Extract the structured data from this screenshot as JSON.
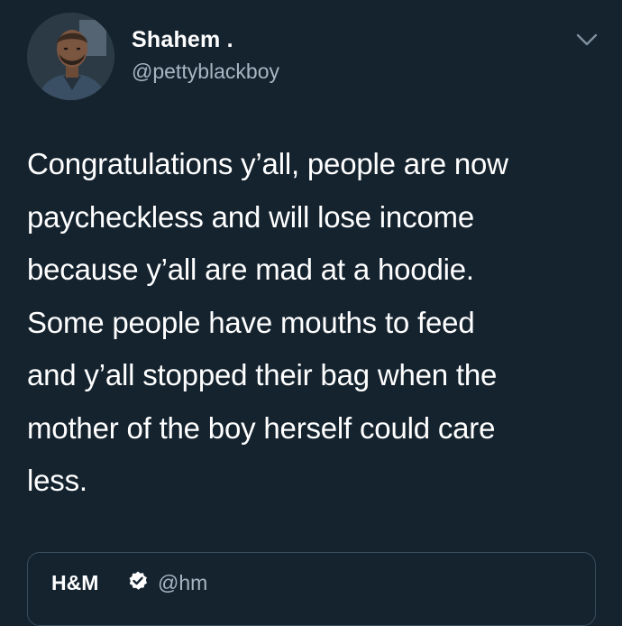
{
  "theme": {
    "background": "#15232f",
    "text": "#ffffff",
    "secondary_text": "#a8b6c3",
    "border": "#3a4d5c"
  },
  "tweet": {
    "author": {
      "display_name": "Shahem .",
      "handle": "@pettyblackboy",
      "avatar_icon": "profile-photo"
    },
    "menu_icon": "chevron-down-icon",
    "text": "Congratulations y’all, people are now\npaycheckless and will lose income\nbecause y’all are mad at a hoodie.\nSome people have mouths to feed\nand y’all stopped their bag when the\nmother of the boy herself could care\nless."
  },
  "quoted_tweet": {
    "display_name": "H&M",
    "verified_icon": "verified-badge-icon",
    "handle": "@hm"
  }
}
